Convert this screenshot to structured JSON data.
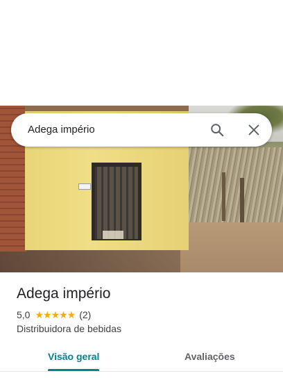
{
  "search": {
    "query": "Adega império"
  },
  "place": {
    "name": "Adega império",
    "rating": "5,0",
    "rating_value": 5,
    "stars": "★★★★★",
    "review_count": "(2)",
    "category": "Distribuidora de bebidas"
  },
  "tabs": [
    {
      "label": "Visão geral",
      "selected": true
    },
    {
      "label": "Avaliações",
      "selected": false
    }
  ],
  "colors": {
    "accent": "#00838f",
    "star": "#f9ab00"
  },
  "icons": {
    "search": "search-icon",
    "close": "close-icon"
  }
}
